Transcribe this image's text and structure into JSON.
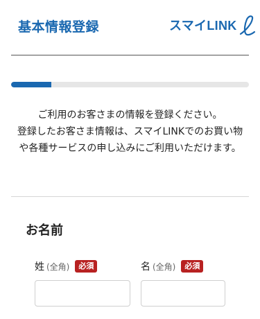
{
  "header": {
    "title": "基本情報登録",
    "logo_text": "スマイLINK",
    "brand_color": "#1a68b0",
    "logo_icon": "swirl-l-icon"
  },
  "progress": {
    "value": 0.17,
    "fill_color": "#1a68b0"
  },
  "intro": {
    "line1": "ご利用のお客さまの情報を登録ください。",
    "line2": "登録したお客さま情報は、スマイLINKでのお買い物や各種サービスの申し込みにご利用いただけます。"
  },
  "section": {
    "heading": "お名前",
    "fields": [
      {
        "label": "姓",
        "hint": "(全角)",
        "badge": "必須",
        "value": ""
      },
      {
        "label": "名",
        "hint": "(全角)",
        "badge": "必須",
        "value": ""
      }
    ]
  },
  "required_badge_color": "#b82121"
}
